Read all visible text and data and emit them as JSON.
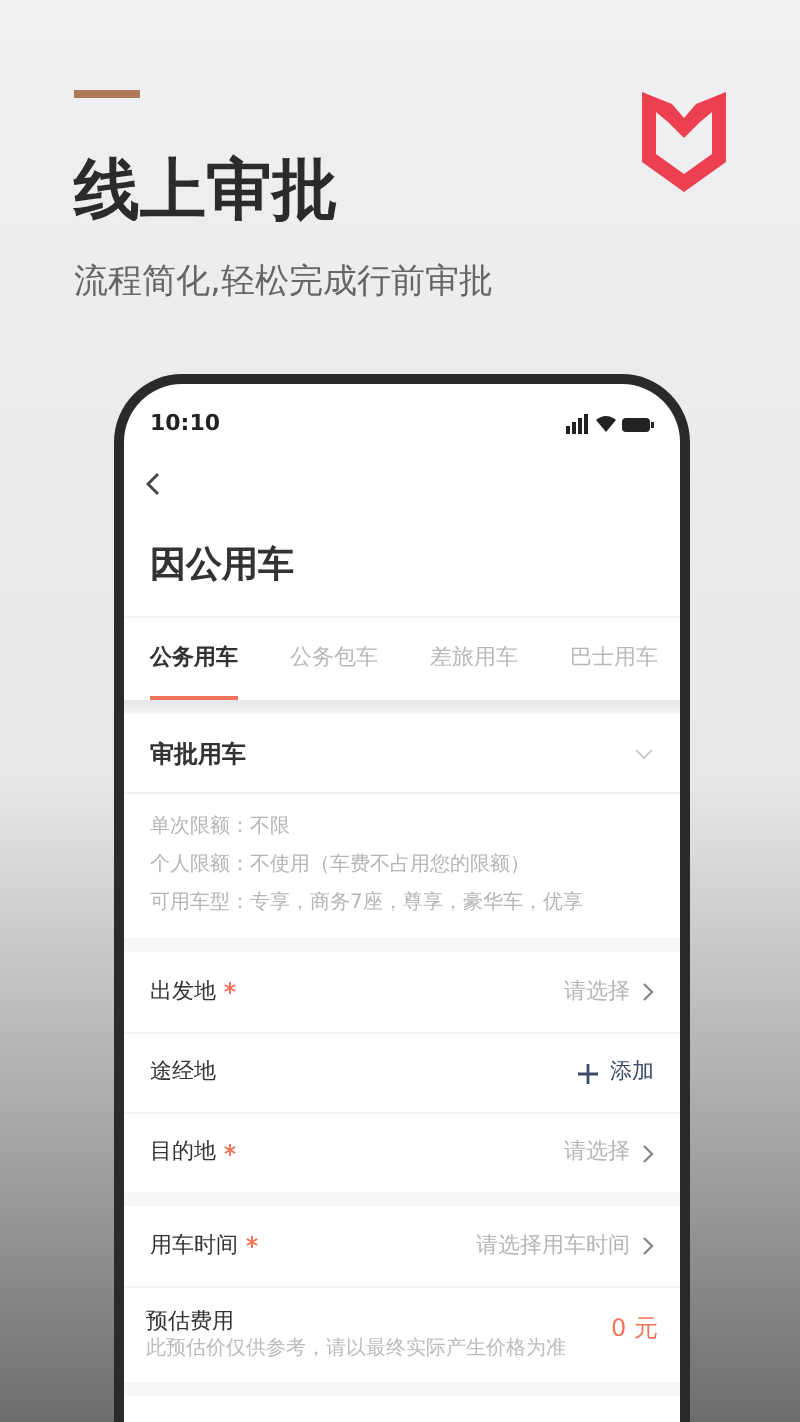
{
  "headline": "线上审批",
  "subtitle": "流程简化,轻松完成行前审批",
  "phone": {
    "status_time": "10:10",
    "page_title": "因公用车",
    "tabs": [
      {
        "label": "公务用车",
        "selected": true
      },
      {
        "label": "公务包车",
        "selected": false
      },
      {
        "label": "差旅用车",
        "selected": false
      },
      {
        "label": "巴士用车",
        "selected": false
      }
    ],
    "approval": {
      "title": "审批用车",
      "details": [
        "单次限额：不限",
        "个人限额：不使用（车费不占用您的限额）",
        "可用车型：专享，商务7座，尊享，豪华车，优享"
      ]
    },
    "route_rows": [
      {
        "kind": "select",
        "label": "出发地",
        "required": true,
        "value": "请选择"
      },
      {
        "kind": "add",
        "label": "途经地",
        "required": false,
        "value": "添加"
      },
      {
        "kind": "select",
        "label": "目的地",
        "required": true,
        "value": "请选择"
      }
    ],
    "time_row": {
      "kind": "select",
      "label": "用车时间",
      "required": true,
      "value": "请选择用车时间"
    },
    "estimate": {
      "label": "预估费用",
      "note": "此预估价仅供参考，请以最终实际产生价格为准",
      "amount": "0 元"
    }
  }
}
